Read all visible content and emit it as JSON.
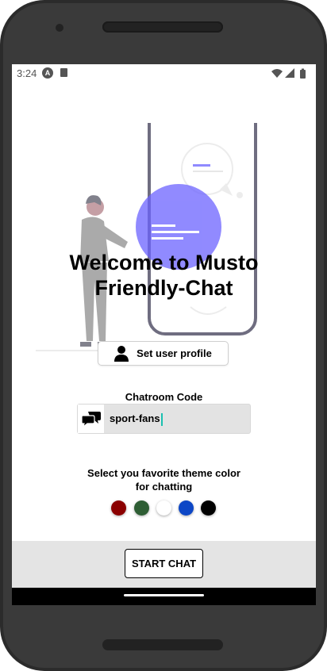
{
  "status_bar": {
    "time": "3:24",
    "icons": [
      "android-a-icon",
      "sd-card-icon",
      "wifi-icon",
      "signal-icon",
      "battery-icon"
    ]
  },
  "main": {
    "title_line1": "Welcome to Musto",
    "title_line2": "Friendly-Chat",
    "profile_button_label": "Set user profile",
    "profile_button_icon": "user-icon",
    "chatroom_label": "Chatroom Code",
    "chatroom_icon": "chat-bubbles-icon",
    "chatroom_value": "sport-fans",
    "theme_label_line1": "Select you favorite theme color",
    "theme_label_line2": "for chatting",
    "theme_colors": [
      "#8b0000",
      "#2e5e34",
      "#ffffff",
      "#0d47c6",
      "#000000"
    ]
  },
  "footer": {
    "start_button_label": "START CHAT"
  },
  "colors": {
    "illustration_accent": "#6c63ff",
    "bottom_bar_bg": "#e4e4e4",
    "cursor": "#1ac0b0"
  }
}
